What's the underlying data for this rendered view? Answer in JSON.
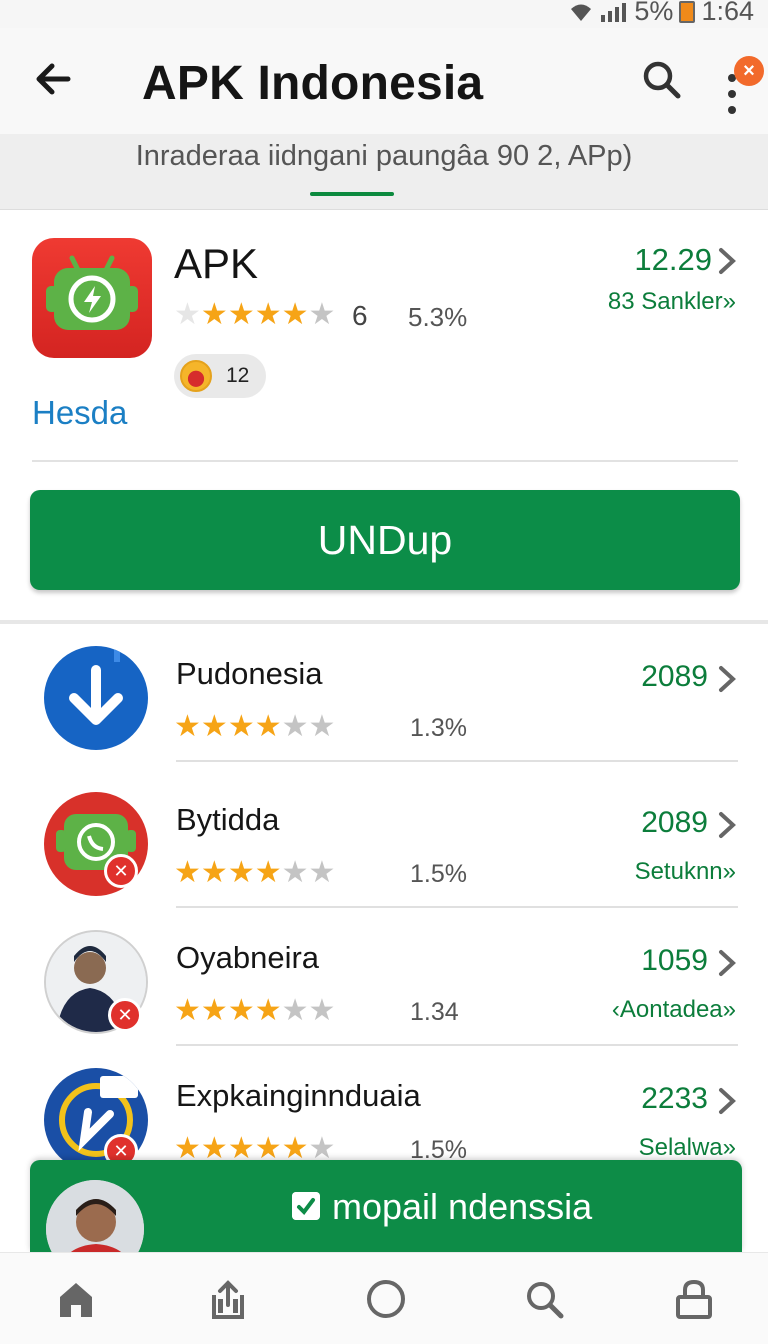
{
  "status": {
    "signal": "5%",
    "time": "1:64"
  },
  "appbar": {
    "title": "APK Indonesia",
    "notification_badge": "×"
  },
  "tabstrip": {
    "label": "Inraderaa iidngani paungâa 90 2, APp)"
  },
  "featured": {
    "name": "APK",
    "rating": 4.5,
    "rating_count": "6",
    "percent": "5.3%",
    "chip_count": "12",
    "developer": "Hesda",
    "value": "12.29",
    "sub": "83 Sankler»",
    "install_label": "UNDup",
    "colors": {
      "accent": "#0c8d48",
      "link": "#1b7fc4",
      "icon_bg": "#e3302c"
    }
  },
  "list": [
    {
      "name": "Pudonesia",
      "rating": 4,
      "percent": "1.3%",
      "value": "2089",
      "sub": "",
      "icon": "download-icon"
    },
    {
      "name": "Bytidda",
      "rating": 3.5,
      "percent": "1.5%",
      "value": "2089",
      "sub": "Setuknn»",
      "icon": "android-whatsapp-icon"
    },
    {
      "name": "Oyabneira",
      "rating": 4,
      "percent": "1.34",
      "value": "1059",
      "sub": "‹Aontadea»",
      "icon": "person-avatar"
    },
    {
      "name": "Expkainginnduaia",
      "rating": 4.5,
      "percent": "1.5%",
      "value": "2233",
      "sub": "Selalwa»",
      "icon": "badge-app-icon"
    }
  ],
  "banner": {
    "label": "mopail ndenssia"
  },
  "bottomnav": [
    "home-icon",
    "share-icon",
    "circle-icon",
    "search-icon",
    "lock-icon"
  ]
}
